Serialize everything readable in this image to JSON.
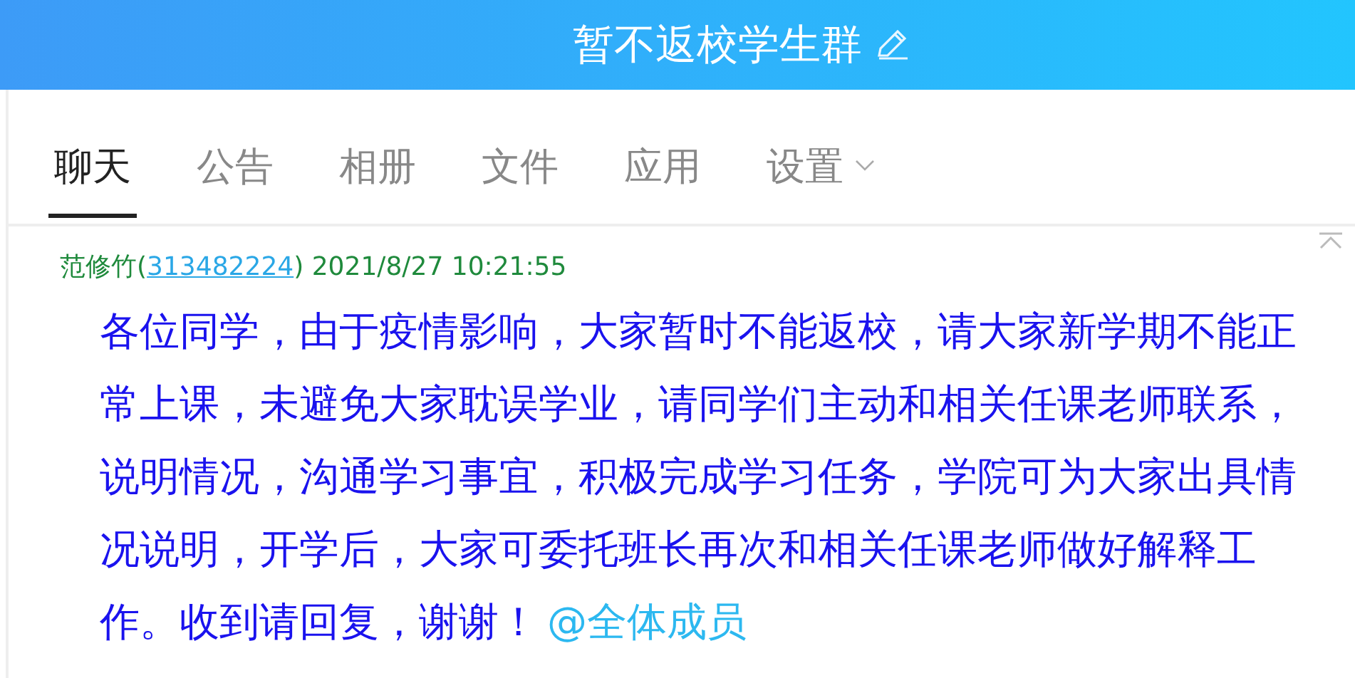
{
  "header": {
    "title": "暂不返校学生群"
  },
  "tabs": [
    {
      "label": "聊天",
      "selected": true,
      "kind": "plain"
    },
    {
      "label": "公告",
      "selected": false,
      "kind": "plain"
    },
    {
      "label": "相册",
      "selected": false,
      "kind": "plain"
    },
    {
      "label": "文件",
      "selected": false,
      "kind": "plain"
    },
    {
      "label": "应用",
      "selected": false,
      "kind": "plain"
    },
    {
      "label": "设置",
      "selected": false,
      "kind": "dropdown"
    }
  ],
  "messages": [
    {
      "sender": "范修竹(",
      "user_id": "313482224",
      "time": ") 2021/8/27 10:21:55",
      "text": "各位同学，由于疫情影响，大家暂时不能返校，请大家新学期不能正常上课，未避免大家耽误学业，请同学们主动和相关任课老师联系，说明情况，沟通学习事宜，积极完成学习任务，学院可为大家出具情况说明，开学后，大家可委托班长再次和相关任课老师做好解释工作。收到请回复，谢谢！",
      "mention": "@全体成员"
    }
  ]
}
